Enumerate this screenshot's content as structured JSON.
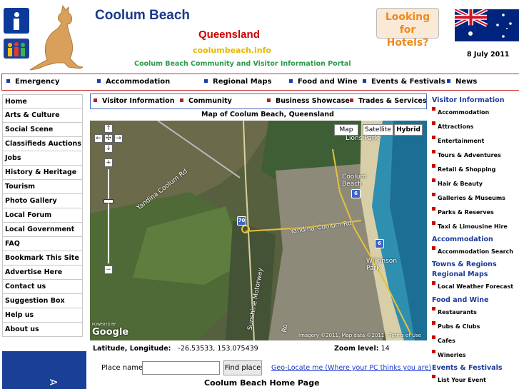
{
  "header": {
    "title": "Coolum Beach",
    "state": "Queensland",
    "domain": "coolumbeach.info",
    "tagline": "Coolum Beach Community and Visitor Information Portal",
    "hotels_button": "Looking for Hotels?",
    "date": "8 July 2011"
  },
  "top_nav": [
    "Emergency",
    "Accommodation",
    "Regional Maps",
    "Food and Wine",
    "Events & Festivals",
    "News"
  ],
  "left_menu": [
    "Home",
    "Arts & Culture",
    "Social Scene",
    "Classifieds Auctions",
    "Jobs",
    "History & Heritage",
    "Tourism",
    "Photo Gallery",
    "Local Forum",
    "Local Government",
    "FAQ",
    "Bookmark This Site",
    "Advertise Here",
    "Contact us",
    "Suggestion Box",
    "Help us",
    "About us"
  ],
  "sub_nav": [
    "Visitor Information",
    "Community",
    "Business Showcase",
    "Trades & Services"
  ],
  "map": {
    "title": "Map of Coolum Beach, Queensland",
    "type_buttons": [
      "Map",
      "Satellite",
      "Hybrid"
    ],
    "active_type": "Hybrid",
    "labels": {
      "town": "Coolum Beach",
      "road1": "Yandina Coolum Rd",
      "road2": "Yandina-Coolum Rd",
      "motorway": "Sunshine Motorway",
      "park": "Lions Park",
      "wilkinson": "Wilkinson Park",
      "other_rd": "Ro"
    },
    "shields": [
      "70",
      "6",
      "6"
    ],
    "google": "Google",
    "powered": "POWERED BY",
    "copyright": "Imagery ©2011, Map data ©2011 - Terms of Use"
  },
  "coords": {
    "label": "Latitude, Longitude:",
    "value": "-26.53533, 153.075439",
    "zoom_label": "Zoom level:",
    "zoom_value": "14"
  },
  "search": {
    "label": "Place name:",
    "placeholder": "",
    "button": "Find place",
    "geo_link": "Geo-Locate me (Where your PC thinks you are)"
  },
  "home_title": "Coolum Beach Home Page",
  "right_menu": {
    "visitor_head": "Visitor Information",
    "visitor_items": [
      "Accommodation",
      "Attractions",
      "Entertainment",
      "Tours & Adventures",
      "Retail & Shopping",
      "Hair & Beauty",
      "Galleries & Museums",
      "Parks & Reserves",
      "Taxi & Limousine Hire"
    ],
    "accom_head": "Accommodation",
    "accom_items": [
      "Accommodation Search"
    ],
    "towns_head": "Towns & Regions",
    "maps_head": "Regional Maps",
    "maps_items": [
      "Local Weather Forecast"
    ],
    "food_head": "Food and Wine",
    "food_items": [
      "Restaurants",
      "Pubs & Clubs",
      "Cafes",
      "Wineries"
    ],
    "events_head": "Events & Festivals",
    "events_items": [
      "List Your Event"
    ]
  },
  "banner_text": "A",
  "colors": {
    "brand_blue": "#1a3a8c",
    "state_red": "#cc0000",
    "domain_yellow": "#e8b800",
    "tagline_green": "#2a9a4a",
    "hotel_orange": "#f08a1c"
  }
}
